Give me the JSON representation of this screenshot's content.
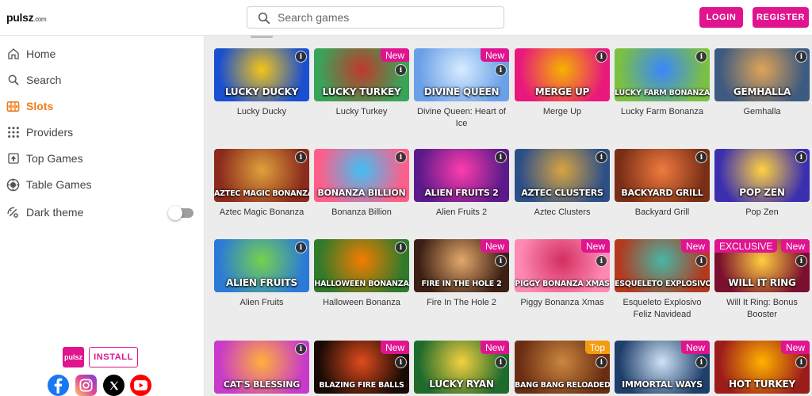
{
  "header": {
    "logo": "pulsz",
    "logo_suffix": ".com",
    "search_placeholder": "Search games",
    "login_label": "LOGIN",
    "register_label": "REGISTER"
  },
  "sidebar": {
    "items": [
      {
        "label": "Home",
        "icon": "home-icon"
      },
      {
        "label": "Search",
        "icon": "search-icon"
      },
      {
        "label": "Slots",
        "icon": "slots-icon",
        "active": true
      },
      {
        "label": "Providers",
        "icon": "providers-icon"
      },
      {
        "label": "Top Games",
        "icon": "top-games-icon"
      },
      {
        "label": "Table Games",
        "icon": "table-games-icon"
      },
      {
        "label": "Dark theme",
        "icon": "dark-theme-icon"
      }
    ],
    "dark_theme_on": false,
    "app_badge": "pulsz",
    "install_label": "INSTALL",
    "socials": [
      "facebook-icon",
      "instagram-icon",
      "x-icon",
      "youtube-icon"
    ]
  },
  "colors": {
    "accent": "#e0148f",
    "active_nav": "#f07b14",
    "top_badge": "#f39c12"
  },
  "games": [
    {
      "title": "Lucky Ducky",
      "art_title": "LUCKY DUCKY",
      "badge": ""
    },
    {
      "title": "Lucky Turkey",
      "art_title": "LUCKY TURKEY",
      "badge": "New"
    },
    {
      "title": "Divine Queen: Heart of Ice",
      "art_title": "DIVINE QUEEN",
      "badge": "New"
    },
    {
      "title": "Merge Up",
      "art_title": "MERGE UP",
      "badge": ""
    },
    {
      "title": "Lucky Farm Bonanza",
      "art_title": "LUCKY FARM BONANZA",
      "badge": ""
    },
    {
      "title": "Gemhalla",
      "art_title": "GEMHALLA",
      "badge": ""
    },
    {
      "title": "Aztec Magic Bonanza",
      "art_title": "AZTEC MAGIC BONANZA",
      "badge": ""
    },
    {
      "title": "Bonanza Billion",
      "art_title": "BONANZA BILLION",
      "badge": ""
    },
    {
      "title": "Alien Fruits 2",
      "art_title": "ALIEN FRUITS 2",
      "badge": ""
    },
    {
      "title": "Aztec Clusters",
      "art_title": "AZTEC CLUSTERS",
      "badge": ""
    },
    {
      "title": "Backyard Grill",
      "art_title": "BACKYARD GRILL",
      "badge": ""
    },
    {
      "title": "Pop Zen",
      "art_title": "POP ZEN",
      "badge": ""
    },
    {
      "title": "Alien Fruits",
      "art_title": "ALIEN FRUITS",
      "badge": ""
    },
    {
      "title": "Halloween Bonanza",
      "art_title": "HALLOWEEN BONANZA",
      "badge": ""
    },
    {
      "title": "Fire In The Hole 2",
      "art_title": "FIRE IN THE HOLE 2",
      "badge": "New"
    },
    {
      "title": "Piggy Bonanza Xmas",
      "art_title": "PIGGY BONANZA XMAS",
      "badge": "New"
    },
    {
      "title": "Esqueleto Explosivo Feliz Navidead",
      "art_title": "ESQUELETO EXPLOSIVO",
      "badge": "New"
    },
    {
      "title": "Will It Ring: Bonus Booster",
      "art_title": "WILL IT RING",
      "badge": "New",
      "badge_left": "EXCLUSIVE"
    },
    {
      "title": "",
      "art_title": "CAT'S BLESSING",
      "badge": ""
    },
    {
      "title": "",
      "art_title": "BLAZING FIRE BALLS",
      "badge": "New"
    },
    {
      "title": "",
      "art_title": "LUCKY RYAN",
      "badge": "New"
    },
    {
      "title": "",
      "art_title": "BANG BANG RELOADED",
      "badge": "Top"
    },
    {
      "title": "",
      "art_title": "IMMORTAL WAYS",
      "badge": "New"
    },
    {
      "title": "",
      "art_title": "HOT TURKEY",
      "badge": "New"
    }
  ]
}
